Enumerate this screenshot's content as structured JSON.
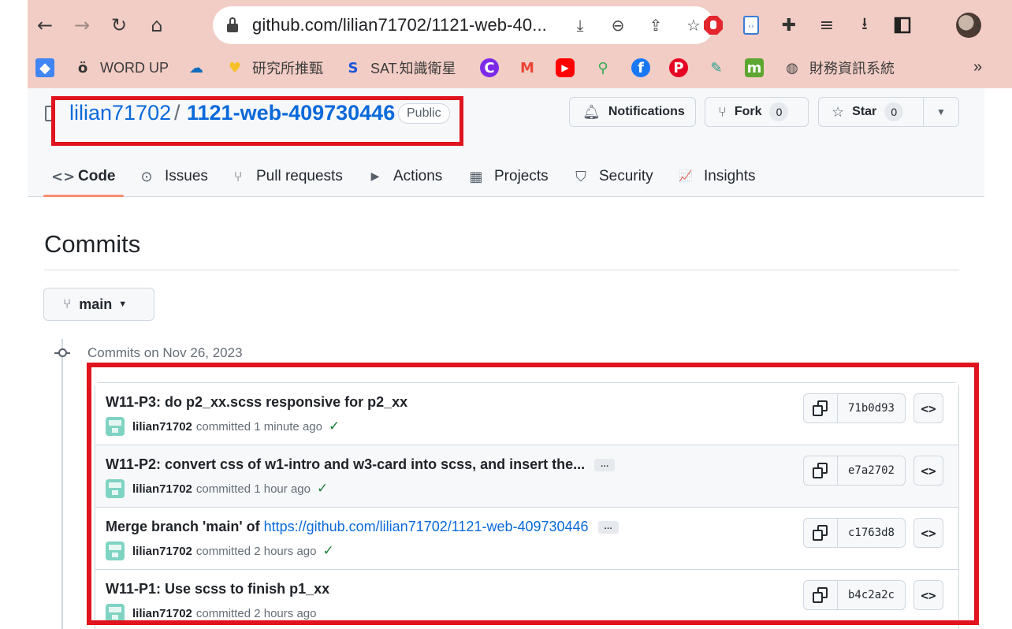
{
  "browser": {
    "url": "github.com/lilian71702/1121-web-40...",
    "bookmarks": [
      {
        "label": "",
        "icon": "layers-icon",
        "color": "#4285f4"
      },
      {
        "label": "WORD UP",
        "icon": "o-umlaut-icon",
        "color": "#333333"
      },
      {
        "label": "",
        "icon": "onedrive-cloud-icon",
        "color": "#0f6cbd"
      },
      {
        "label": "研究所推甄",
        "icon": "yellow-heart-icon",
        "color": "#f6c026"
      },
      {
        "label": "SAT.知識衛星",
        "icon": "sat-logo-icon",
        "color": "#1a56db"
      },
      {
        "label": "",
        "icon": "canva-icon",
        "color": "#7d2ae8"
      },
      {
        "label": "",
        "icon": "gmail-icon",
        "color": "#ea4335"
      },
      {
        "label": "",
        "icon": "youtube-icon",
        "color": "#ff0000"
      },
      {
        "label": "",
        "icon": "maps-pin-icon",
        "color": "#34a853"
      },
      {
        "label": "",
        "icon": "facebook-icon",
        "color": "#1877f2"
      },
      {
        "label": "",
        "icon": "pinterest-icon",
        "color": "#e60023"
      },
      {
        "label": "",
        "icon": "tools-icon",
        "color": "#20a090"
      },
      {
        "label": "",
        "icon": "moodle-icon",
        "color": "#5da631"
      },
      {
        "label": "財務資訊系統",
        "icon": "globe-icon",
        "color": "#444444"
      }
    ],
    "more": "»"
  },
  "repo": {
    "owner": "lilian71702",
    "separator": "/",
    "name": "1121-web-409730446",
    "visibility": "Public",
    "notifications_label": "Notifications",
    "fork_label": "Fork",
    "fork_count": "0",
    "star_label": "Star",
    "star_count": "0"
  },
  "tabs": [
    {
      "label": "Code",
      "icon": "code-icon",
      "glyph": "<>"
    },
    {
      "label": "Issues",
      "icon": "issue-circle-icon",
      "glyph": "⊙"
    },
    {
      "label": "Pull requests",
      "icon": "pull-request-icon",
      "glyph": "⑂"
    },
    {
      "label": "Actions",
      "icon": "play-circle-icon",
      "glyph": "▶"
    },
    {
      "label": "Projects",
      "icon": "table-icon",
      "glyph": "▦"
    },
    {
      "label": "Security",
      "icon": "shield-icon",
      "glyph": "⛉"
    },
    {
      "label": "Insights",
      "icon": "graph-icon",
      "glyph": "📈"
    }
  ],
  "page": {
    "title": "Commits",
    "branch": "main",
    "day_label": "Commits on Nov 26, 2023"
  },
  "commits": [
    {
      "message": "W11-P3: do p2_xx.scss responsive for p2_xx",
      "link": "",
      "expand": "",
      "author": "lilian71702",
      "action": "committed 1 minute ago",
      "status": "✓",
      "sha": "71b0d93"
    },
    {
      "message": "W11-P2: convert css of w1-intro and w3-card into scss, and insert the...",
      "link": "",
      "expand": "…",
      "author": "lilian71702",
      "action": "committed 1 hour ago",
      "status": "✓",
      "sha": "e7a2702"
    },
    {
      "message": "Merge branch 'main' of ",
      "link": "https://github.com/lilian71702/1121-web-409730446",
      "expand": "…",
      "author": "lilian71702",
      "action": "committed 2 hours ago",
      "status": "✓",
      "sha": "c1763d8"
    },
    {
      "message": "W11-P1: Use scss to finish p1_xx",
      "link": "",
      "expand": "",
      "author": "lilian71702",
      "action": "committed 2 hours ago",
      "status": "",
      "sha": "b4c2a2c"
    }
  ],
  "colors": {
    "accent_link": "#0969da",
    "highlight_box": "#e0141e",
    "browser_chrome": "#f2cdc5",
    "success": "#1a7f37"
  }
}
